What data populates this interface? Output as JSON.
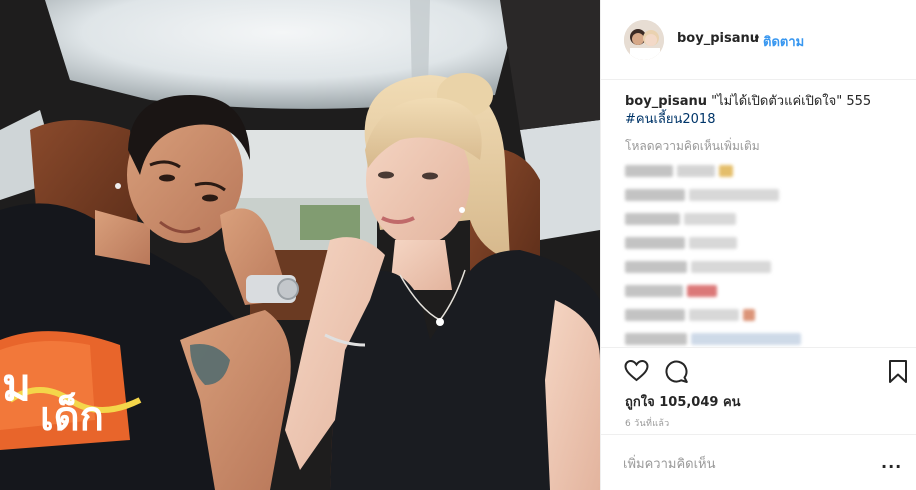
{
  "post": {
    "username": "boy_pisanu",
    "separator": "•",
    "follow_label": "ติดตาม"
  },
  "caption": {
    "username": "boy_pisanu",
    "text": "\"ไม่ได้เปิดตัวแค่เปิดใจ\" 555",
    "hashtag": "#คนเลี้ยน2018"
  },
  "comments": {
    "load_more": "โหลดความคิดเห็นเพิ่มเติม"
  },
  "engagement": {
    "likes": "ถูกใจ 105,049 คน",
    "time": "6 วันที่แล้ว"
  },
  "comment_box": {
    "placeholder": "เพิ่มความคิดเห็น",
    "more_label": "..."
  },
  "icons": [
    "heart-icon",
    "comment-icon",
    "bookmark-icon",
    "more-icon"
  ],
  "colors": {
    "link": "#3897f0",
    "hashtag": "#003569",
    "muted": "#999999",
    "text": "#262626",
    "divider": "#efefef"
  }
}
